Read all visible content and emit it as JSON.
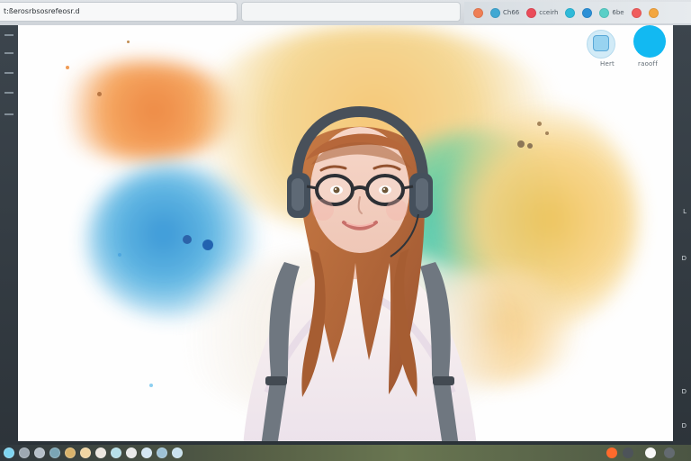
{
  "topbar": {
    "address_text": "t:ßerosrbsosrefeosr.d",
    "tab_title": "",
    "tray_labels": [
      "Ch66",
      "cceirh",
      "6be"
    ]
  },
  "canvas": {
    "button_labels": [
      "Hert",
      "raooff"
    ]
  },
  "right_letters": [
    "L",
    "D",
    "D",
    "D"
  ],
  "colors": {
    "chrome_light": "#dfe3e7",
    "chrome_dark": "#2f373d",
    "accent_blue": "#12b9f2",
    "accent_light_blue": "#cfeaf8",
    "watercolor_orange": "#f29a45",
    "watercolor_blue": "#4aa9de",
    "watercolor_teal": "#52c3be",
    "watercolor_yellow": "#f5cf6b",
    "hair_auburn": "#b56a39"
  },
  "icons": [
    "address-bar-icon",
    "tab-icon",
    "tray-circle-icon",
    "app-button-icon",
    "taskbar-app-icon"
  ]
}
